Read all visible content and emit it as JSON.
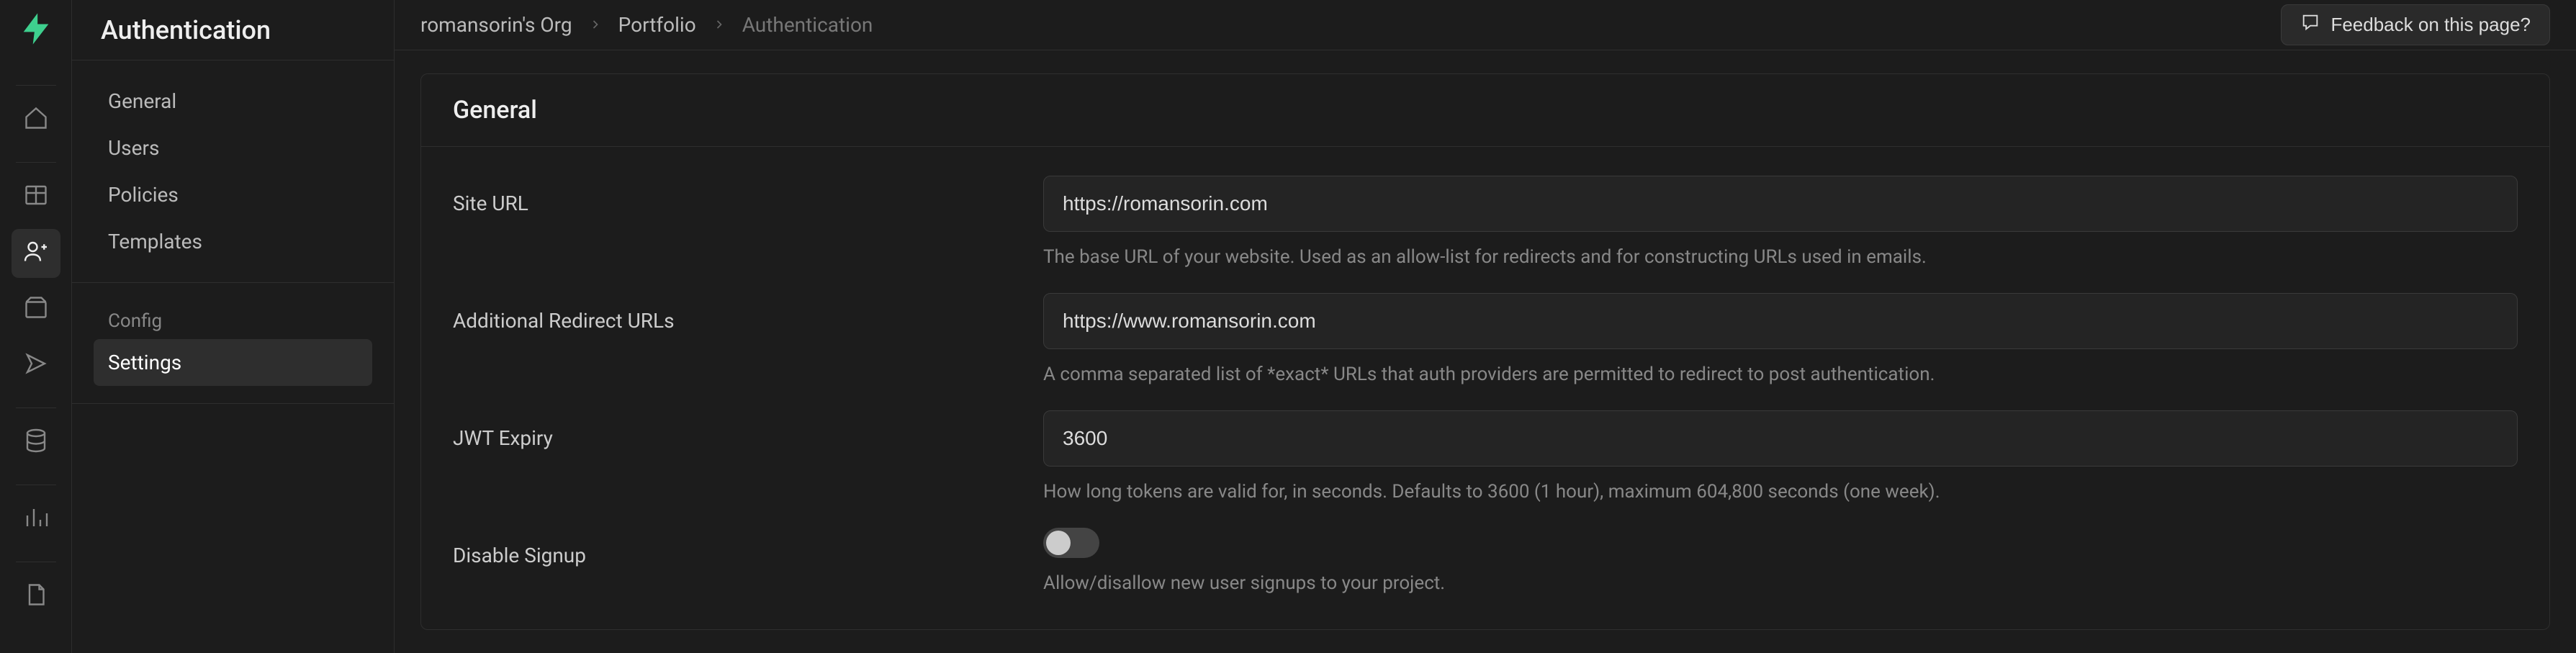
{
  "page_title": "Authentication",
  "breadcrumbs": {
    "org": "romansorin's Org",
    "project": "Portfolio",
    "current": "Authentication"
  },
  "feedback_label": "Feedback on this page?",
  "rail": {
    "items": [
      {
        "name": "home-icon"
      },
      {
        "name": "table-icon"
      },
      {
        "name": "auth-icon",
        "active": true
      },
      {
        "name": "storage-icon"
      },
      {
        "name": "edge-icon"
      },
      {
        "name": "database-icon"
      },
      {
        "name": "reports-icon"
      },
      {
        "name": "docs-icon"
      }
    ]
  },
  "sidebar": {
    "groups": [
      {
        "label": null,
        "items": [
          {
            "label": "General"
          },
          {
            "label": "Users"
          },
          {
            "label": "Policies"
          },
          {
            "label": "Templates"
          }
        ]
      },
      {
        "label": "Config",
        "items": [
          {
            "label": "Settings",
            "active": true
          }
        ]
      }
    ]
  },
  "card": {
    "title": "General",
    "site_url": {
      "label": "Site URL",
      "value": "https://romansorin.com",
      "help": "The base URL of your website. Used as an allow-list for redirects and for constructing URLs used in emails."
    },
    "redirect_urls": {
      "label": "Additional Redirect URLs",
      "value": "https://www.romansorin.com",
      "help": "A comma separated list of *exact* URLs that auth providers are permitted to redirect to post authentication."
    },
    "jwt_expiry": {
      "label": "JWT Expiry",
      "value": "3600",
      "help": "How long tokens are valid for, in seconds. Defaults to 3600 (1 hour), maximum 604,800 seconds (one week)."
    },
    "disable_signup": {
      "label": "Disable Signup",
      "value": false,
      "help": "Allow/disallow new user signups to your project."
    }
  },
  "colors": {
    "accent": "#3ecf8e",
    "bg": "#1c1c1c",
    "panel": "#242424",
    "border": "#2e2e2e",
    "text_muted": "#888888"
  }
}
